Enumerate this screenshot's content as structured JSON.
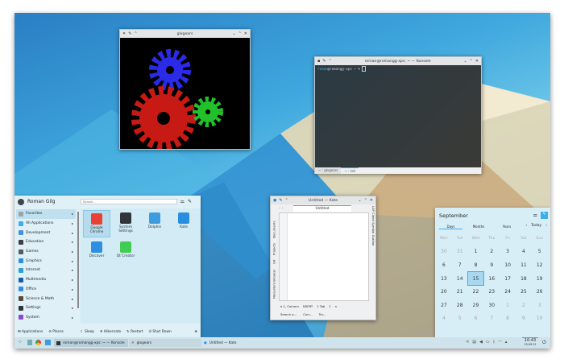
{
  "glxgears": {
    "title": "glxgears"
  },
  "konsole": {
    "title": "roman@romangg-xps: ~ — Konsole",
    "prompt_user": "roman",
    "prompt_rest": "@romangg-xps ~ % ",
    "tabs": [
      "~ : glxgears",
      "~ : zsh"
    ]
  },
  "kate": {
    "title": "Untitled — Kate",
    "tab": "Untitled",
    "line_number": "1",
    "side_left": [
      "Documents",
      "Projects",
      "Git",
      "Filesystem Browser"
    ],
    "side_right": "LSP Client Symbol Outline",
    "status": [
      "e 1, Column",
      "NSERT",
      "1 Tab",
      "1",
      "n"
    ],
    "bottom": [
      "Search a...",
      "Curr...",
      "Ter..."
    ]
  },
  "launcher": {
    "user": "Roman Gilg",
    "search_placeholder": "Search...",
    "categories": [
      {
        "label": "Favorites",
        "color": "#9aa4ab"
      },
      {
        "label": "All Applications",
        "color": "#3daee9"
      },
      {
        "label": "Development",
        "color": "#4a90d9"
      },
      {
        "label": "Education",
        "color": "#3b3f44"
      },
      {
        "label": "Games",
        "color": "#555a60"
      },
      {
        "label": "Graphics",
        "color": "#2b8fe0"
      },
      {
        "label": "Internet",
        "color": "#2aa1d8"
      },
      {
        "label": "Multimedia",
        "color": "#1d5aa8"
      },
      {
        "label": "Office",
        "color": "#3a8be0"
      },
      {
        "label": "Science & Math",
        "color": "#5a4a3a"
      },
      {
        "label": "Settings",
        "color": "#2f3439"
      },
      {
        "label": "System",
        "color": "#8a4ac8"
      }
    ],
    "apps": [
      {
        "label": "Google Chrome",
        "color": "#e94235"
      },
      {
        "label": "System Settings",
        "color": "#2f3439"
      },
      {
        "label": "Dolphin",
        "color": "#3d9be0"
      },
      {
        "label": "Kate",
        "color": "#2a8ee0"
      },
      {
        "label": "Discover",
        "color": "#2e8ee0"
      },
      {
        "label": "Qt Creator",
        "color": "#41cd52"
      }
    ],
    "footer": {
      "applications": "Applications",
      "places": "Places",
      "sleep": "Sleep",
      "hibernate": "Hibernate",
      "restart": "Restart",
      "shutdown": "Shut Down"
    }
  },
  "calendar": {
    "month": "September",
    "tabs": [
      "Days",
      "Months",
      "Years"
    ],
    "today": "Today",
    "weekdays": [
      "Mon",
      "Tue",
      "Wed",
      "Thu",
      "Fri",
      "Sat",
      "Sun"
    ],
    "weeks": [
      [
        "30",
        "31",
        "1",
        "2",
        "3",
        "4",
        "5"
      ],
      [
        "6",
        "7",
        "8",
        "9",
        "10",
        "11",
        "12"
      ],
      [
        "13",
        "14",
        "15",
        "16",
        "17",
        "18",
        "19"
      ],
      [
        "20",
        "21",
        "22",
        "23",
        "24",
        "25",
        "26"
      ],
      [
        "27",
        "28",
        "29",
        "30",
        "1",
        "2",
        "3"
      ],
      [
        "4",
        "5",
        "6",
        "7",
        "8",
        "9",
        "10"
      ]
    ],
    "selected": "15"
  },
  "taskbar": {
    "tasks": [
      "roman@romangg-xps: ~ — Konsole",
      "glxgears",
      "Untitled — Kate"
    ],
    "time": "10:43",
    "date": "15.09.21"
  }
}
